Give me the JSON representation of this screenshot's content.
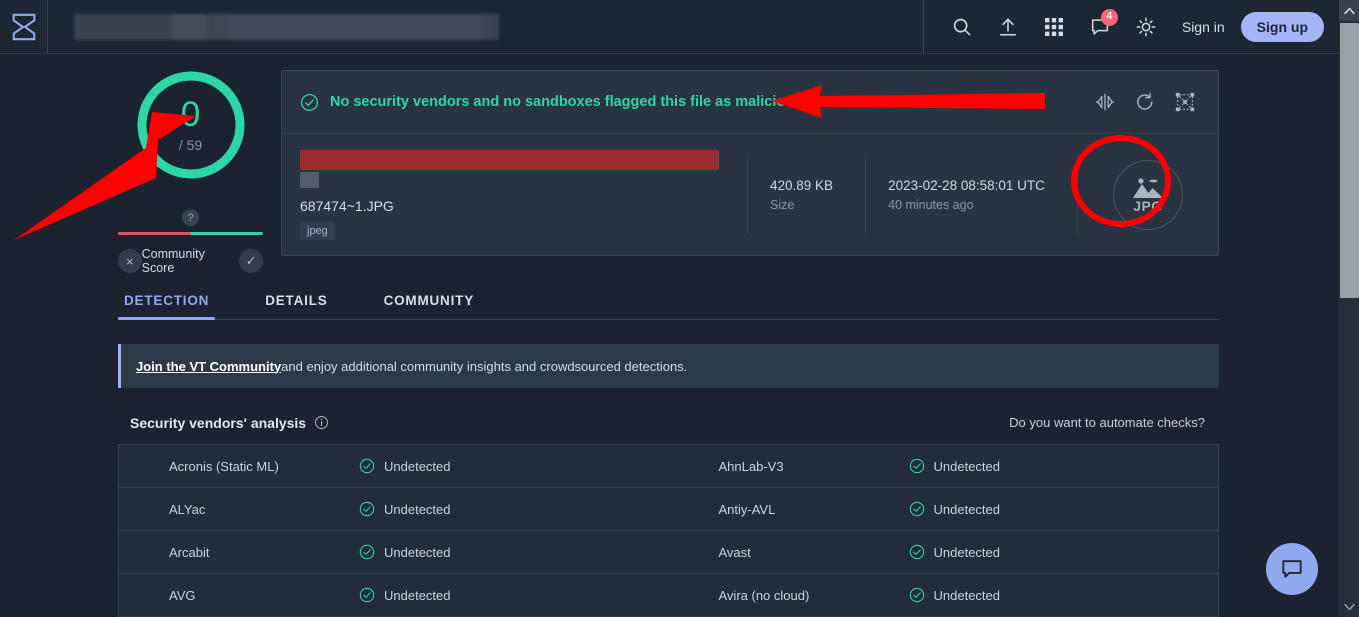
{
  "header": {
    "logo_icon": "sigma-logo",
    "search_placeholder": "",
    "search_value": "",
    "icons": [
      {
        "name": "search-icon",
        "label": "Search"
      },
      {
        "name": "upload-icon",
        "label": "Upload"
      },
      {
        "name": "apps-grid-icon",
        "label": "Apps"
      },
      {
        "name": "chat-icon",
        "label": "Messages",
        "badge": "4"
      },
      {
        "name": "theme-sun-icon",
        "label": "Theme"
      }
    ],
    "notification_count": "4",
    "sign_in_label": "Sign in",
    "sign_up_label": "Sign up"
  },
  "score": {
    "detections": "0",
    "total": "/ 59",
    "help_icon": "?",
    "community_label": "Community Score",
    "downvote_icon": "×",
    "upvote_icon": "✓",
    "ring_color": "#2fd6a5",
    "bar_negative_color": "#d4576b",
    "bar_positive_color": "#2fd6a5"
  },
  "file_card": {
    "verdict_text": "No security vendors and no sandboxes flagged this file as malicious",
    "verdict_color": "#2fd6a5",
    "actions": [
      {
        "name": "compare-icon",
        "label": "Compare"
      },
      {
        "name": "reanalyze-icon",
        "label": "Reanalyze"
      },
      {
        "name": "similar-graph-icon",
        "label": "Similar"
      }
    ],
    "hash_redacted": true,
    "filename": "687474~1.JPG",
    "tag": "jpeg",
    "size_value": "420.89 KB",
    "size_label": "Size",
    "date_value": "2023-02-28 08:58:01 UTC",
    "date_label": "40 minutes ago",
    "filetype_icon": "image-file-icon",
    "filetype_label": "JPG"
  },
  "tabs": [
    {
      "label": "DETECTION",
      "active": true
    },
    {
      "label": "DETAILS",
      "active": false
    },
    {
      "label": "COMMUNITY",
      "active": false
    }
  ],
  "community_banner": {
    "link_text": "Join the VT Community",
    "rest_text": " and enjoy additional community insights and crowdsourced detections."
  },
  "vendors_section": {
    "title": "Security vendors' analysis",
    "info_icon": "info-icon",
    "automate_link": "Do you want to automate checks?",
    "status_icon": "check-circle-icon",
    "rows": [
      {
        "left_name": "Acronis (Static ML)",
        "left_status": "Undetected",
        "right_name": "AhnLab-V3",
        "right_status": "Undetected"
      },
      {
        "left_name": "ALYac",
        "left_status": "Undetected",
        "right_name": "Antiy-AVL",
        "right_status": "Undetected"
      },
      {
        "left_name": "Arcabit",
        "left_status": "Undetected",
        "right_name": "Avast",
        "right_status": "Undetected"
      },
      {
        "left_name": "AVG",
        "left_status": "Undetected",
        "right_name": "Avira (no cloud)",
        "right_status": "Undetected"
      }
    ]
  },
  "fab": {
    "icon": "chat-bubble-icon",
    "color": "#8fa8f0"
  },
  "scrollbar": {
    "up_arrow": "▲",
    "down_arrow": "▼"
  },
  "annotations": {
    "arrow_color": "#ff0000",
    "arrow_to_score": "points at detection score donut",
    "arrow_to_verdict": "points at verdict banner",
    "circle_on_filetype": "highlights JPG file type icon"
  }
}
